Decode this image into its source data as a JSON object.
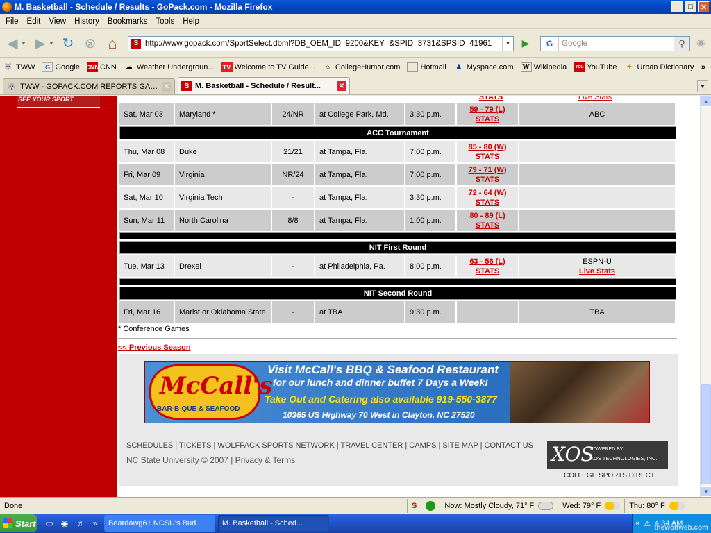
{
  "window": {
    "title": "M. Basketball - Schedule / Results - GoPack.com - Mozilla Firefox",
    "btn_min": "_",
    "btn_max": "□",
    "btn_close": "✕"
  },
  "menu": [
    "File",
    "Edit",
    "View",
    "History",
    "Bookmarks",
    "Tools",
    "Help"
  ],
  "nav": {
    "url": "http://www.gopack.com/SportSelect.dbml?DB_OEM_ID=9200&KEY=&SPID=3731&SPSID=41961",
    "search_placeholder": "Google",
    "search_engine_letter": "G"
  },
  "bookmarks": [
    "TWW",
    "Google",
    "CNN",
    "Weather Undergroun...",
    "Welcome to TV Guide...",
    "CollegeHumor.com",
    "Hotmail",
    "Myspace.com",
    "Wikipedia",
    "YouTube",
    "Urban Dictionary"
  ],
  "bookmarks_more": "»",
  "tabs": [
    {
      "label": "TWW - GOPACK.COM REPORTS GAME...",
      "active": false
    },
    {
      "label": "M. Basketball - Schedule / Result...",
      "active": true
    }
  ],
  "page": {
    "side_banner": "SEE YOUR SPORT",
    "top_partial": {
      "result": "STATS",
      "tv": "Live Stats"
    },
    "rows": [
      {
        "type": "game",
        "date": "Sat, Mar 03",
        "opponent": "Maryland *",
        "rank": "24/NR",
        "location": "at College Park, Md.",
        "time": "3:30 p.m.",
        "result": "59 - 79 (L)",
        "stats": "STATS",
        "tv": "ABC",
        "tv2": ""
      },
      {
        "type": "header",
        "label": "ACC Tournament"
      },
      {
        "type": "game",
        "date": "Thu, Mar 08",
        "opponent": "Duke",
        "rank": "21/21",
        "location": "at Tampa, Fla.",
        "time": "7:00 p.m.",
        "result": "85 - 80 (W)",
        "stats": "STATS",
        "tv": "",
        "tv2": ""
      },
      {
        "type": "game",
        "date": "Fri, Mar 09",
        "opponent": "Virginia",
        "rank": "NR/24",
        "location": "at Tampa, Fla.",
        "time": "7:00 p.m.",
        "result": "79 - 71 (W)",
        "stats": "STATS",
        "tv": "",
        "tv2": ""
      },
      {
        "type": "game",
        "date": "Sat, Mar 10",
        "opponent": "Virginia Tech",
        "rank": "-",
        "location": "at Tampa, Fla.",
        "time": "3:30 p.m.",
        "result": "72 - 64 (W)",
        "stats": "STATS",
        "tv": "",
        "tv2": ""
      },
      {
        "type": "game",
        "date": "Sun, Mar 11",
        "opponent": "North Carolina",
        "rank": "8/8",
        "location": "at Tampa, Fla.",
        "time": "1:00 p.m.",
        "result": "80 - 89 (L)",
        "stats": "STATS",
        "tv": "",
        "tv2": ""
      },
      {
        "type": "blank"
      },
      {
        "type": "header",
        "label": "NIT First Round"
      },
      {
        "type": "game",
        "date": "Tue, Mar 13",
        "opponent": "Drexel",
        "rank": "-",
        "location": "at Philadelphia, Pa.",
        "time": "8:00 p.m.",
        "result": "63 - 56 (L)",
        "stats": "STATS",
        "tv": "ESPN-U",
        "tv2": "Live Stats"
      },
      {
        "type": "blank"
      },
      {
        "type": "header",
        "label": "NIT Second Round"
      },
      {
        "type": "game",
        "date": "Fri, Mar 16",
        "opponent": "Marist or Oklahoma State",
        "rank": "-",
        "location": "at TBA",
        "time": "9:30 p.m.",
        "result": "",
        "stats": "",
        "tv": "TBA",
        "tv2": ""
      }
    ],
    "conference_note": "* Conference Games",
    "prev_season": "<< Previous Season",
    "ad": {
      "logo": "McCall's",
      "logo_sub": "BAR-B-QUE & SEAFOOD",
      "line1": "Visit McCall's BBQ & Seafood Restaurant",
      "line2": "for our lunch and dinner buffet 7 Days a Week!",
      "line3": "Take Out and Catering also available   919-550-3877",
      "line4": "10365 US Highway 70 West in Clayton, NC 27520"
    },
    "footer_links": "SCHEDULES |  TICKETS |  WOLFPACK SPORTS NETWORK |  TRAVEL CENTER |  CAMPS |  SITE MAP |  CONTACT US",
    "footer_line2": "NC State University   © 2007 |   Privacy & Terms",
    "xos_logo": "XOS",
    "xos_powered": "POWERED BY",
    "xos_company": "XOS TECHNOLOGIES, INC.",
    "xos_caption": "COLLEGE SPORTS DIRECT"
  },
  "status": {
    "text": "Done",
    "weather_now": "Now: Mostly Cloudy, 71° F",
    "weather_wed": "Wed: 79° F",
    "weather_thu": "Thu: 80° F"
  },
  "taskbar": {
    "start": "Start",
    "tasks": [
      {
        "label": "Beardawg61 NCSU's Bud...",
        "active": false
      },
      {
        "label": "M. Basketball - Sched...",
        "active": true
      }
    ],
    "clock": "4:34 AM",
    "tray_more": "«",
    "watermark": "thewolfweb.com"
  }
}
